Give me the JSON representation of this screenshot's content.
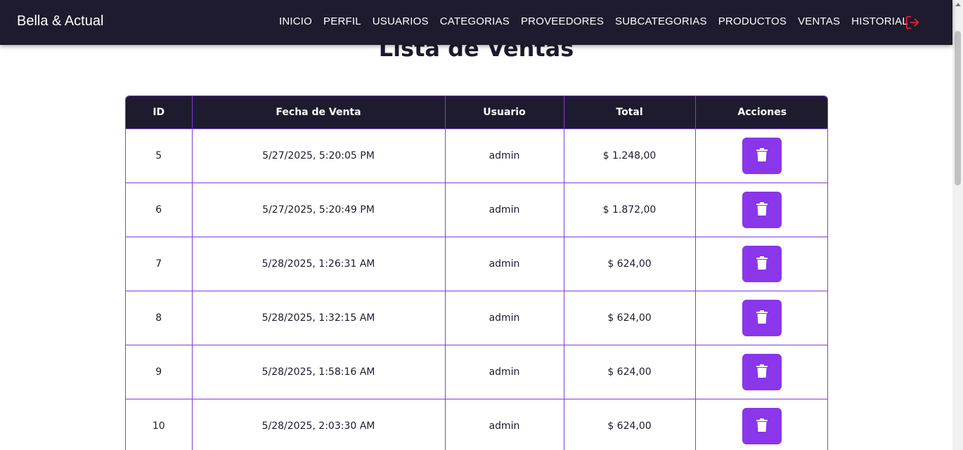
{
  "brand": "Bella & Actual",
  "nav": [
    "INICIO",
    "PERFIL",
    "USUARIOS",
    "CATEGORIAS",
    "PROVEEDORES",
    "SUBCATEGORIAS",
    "PRODUCTOS",
    "VENTAS",
    "HISTORIAL"
  ],
  "logout_icon": "logout-icon",
  "title": "Lista de Ventas",
  "table": {
    "headers": [
      "ID",
      "Fecha de Venta",
      "Usuario",
      "Total",
      "Acciones"
    ],
    "rows": [
      {
        "id": "5",
        "fecha": "5/27/2025, 5:20:05 PM",
        "usuario": "admin",
        "total": "$ 1.248,00"
      },
      {
        "id": "6",
        "fecha": "5/27/2025, 5:20:49 PM",
        "usuario": "admin",
        "total": "$ 1.872,00"
      },
      {
        "id": "7",
        "fecha": "5/28/2025, 1:26:31 AM",
        "usuario": "admin",
        "total": "$ 624,00"
      },
      {
        "id": "8",
        "fecha": "5/28/2025, 1:32:15 AM",
        "usuario": "admin",
        "total": "$ 624,00"
      },
      {
        "id": "9",
        "fecha": "5/28/2025, 1:58:16 AM",
        "usuario": "admin",
        "total": "$ 624,00"
      },
      {
        "id": "10",
        "fecha": "5/28/2025, 2:03:30 AM",
        "usuario": "admin",
        "total": "$ 624,00"
      }
    ],
    "action_icon": "trash-icon"
  },
  "colors": {
    "navbar": "#1e1b2e",
    "accent": "#8a36ea",
    "logout": "#e5202e"
  }
}
